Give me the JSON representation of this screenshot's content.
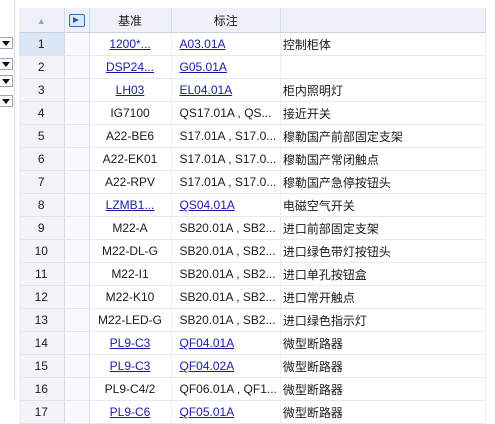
{
  "header": {
    "sort_glyph": "▲",
    "col_standard": "基准",
    "col_mark": "标注",
    "col_desc": ""
  },
  "rows": [
    {
      "n": "1",
      "std": "1200*...",
      "mark": "A03.01A",
      "desc": "控制柜体",
      "std_link": true,
      "mark_link": true
    },
    {
      "n": "2",
      "std": "DSP24...",
      "mark": "G05.01A",
      "desc": "",
      "std_link": true,
      "mark_link": true
    },
    {
      "n": "3",
      "std": "LH03",
      "mark": "EL04.01A",
      "desc": "柜内照明灯",
      "std_link": true,
      "mark_link": true
    },
    {
      "n": "4",
      "std": "IG7100",
      "mark": "QS17.01A , QS...",
      "desc": "接近开关",
      "std_link": false,
      "mark_link": false
    },
    {
      "n": "5",
      "std": "A22-BE6",
      "mark": "S17.01A , S17.0...",
      "desc": "穆勒国产前部固定支架",
      "std_link": false,
      "mark_link": false
    },
    {
      "n": "6",
      "std": "A22-EK01",
      "mark": "S17.01A , S17.0...",
      "desc": "穆勒国产常闭触点",
      "std_link": false,
      "mark_link": false
    },
    {
      "n": "7",
      "std": "A22-RPV",
      "mark": "S17.01A , S17.0...",
      "desc": "穆勒国产急停按钮头",
      "std_link": false,
      "mark_link": false
    },
    {
      "n": "8",
      "std": "LZMB1...",
      "mark": "QS04.01A",
      "desc": "电磁空气开关",
      "std_link": true,
      "mark_link": true
    },
    {
      "n": "9",
      "std": "M22-A",
      "mark": "SB20.01A , SB2...",
      "desc": "进口前部固定支架",
      "std_link": false,
      "mark_link": false
    },
    {
      "n": "10",
      "std": "M22-DL-G",
      "mark": "SB20.01A , SB2...",
      "desc": "进口绿色带灯按钮头",
      "std_link": false,
      "mark_link": false
    },
    {
      "n": "11",
      "std": "M22-I1",
      "mark": "SB20.01A , SB2...",
      "desc": "进口单孔按钮盒",
      "std_link": false,
      "mark_link": false
    },
    {
      "n": "12",
      "std": "M22-K10",
      "mark": "SB20.01A , SB2...",
      "desc": "进口常开触点",
      "std_link": false,
      "mark_link": false
    },
    {
      "n": "13",
      "std": "M22-LED-G",
      "mark": "SB20.01A , SB2...",
      "desc": "进口绿色指示灯",
      "std_link": false,
      "mark_link": false
    },
    {
      "n": "14",
      "std": "PL9-C3",
      "mark": "QF04.01A",
      "desc": "微型断路器",
      "std_link": true,
      "mark_link": true
    },
    {
      "n": "15",
      "std": "PL9-C3",
      "mark": "QF04.02A",
      "desc": "微型断路器",
      "std_link": true,
      "mark_link": true
    },
    {
      "n": "16",
      "std": "PL9-C4/2",
      "mark": "QF06.01A , QF1...",
      "desc": "微型断路器",
      "std_link": false,
      "mark_link": false
    },
    {
      "n": "17",
      "std": "PL9-C6",
      "mark": "QF05.01A",
      "desc": "微型断路器",
      "std_link": true,
      "mark_link": true
    }
  ],
  "icons": {
    "pin_column": "pin-arrow-icon",
    "left_dropdown": "chevron-down-icon"
  }
}
